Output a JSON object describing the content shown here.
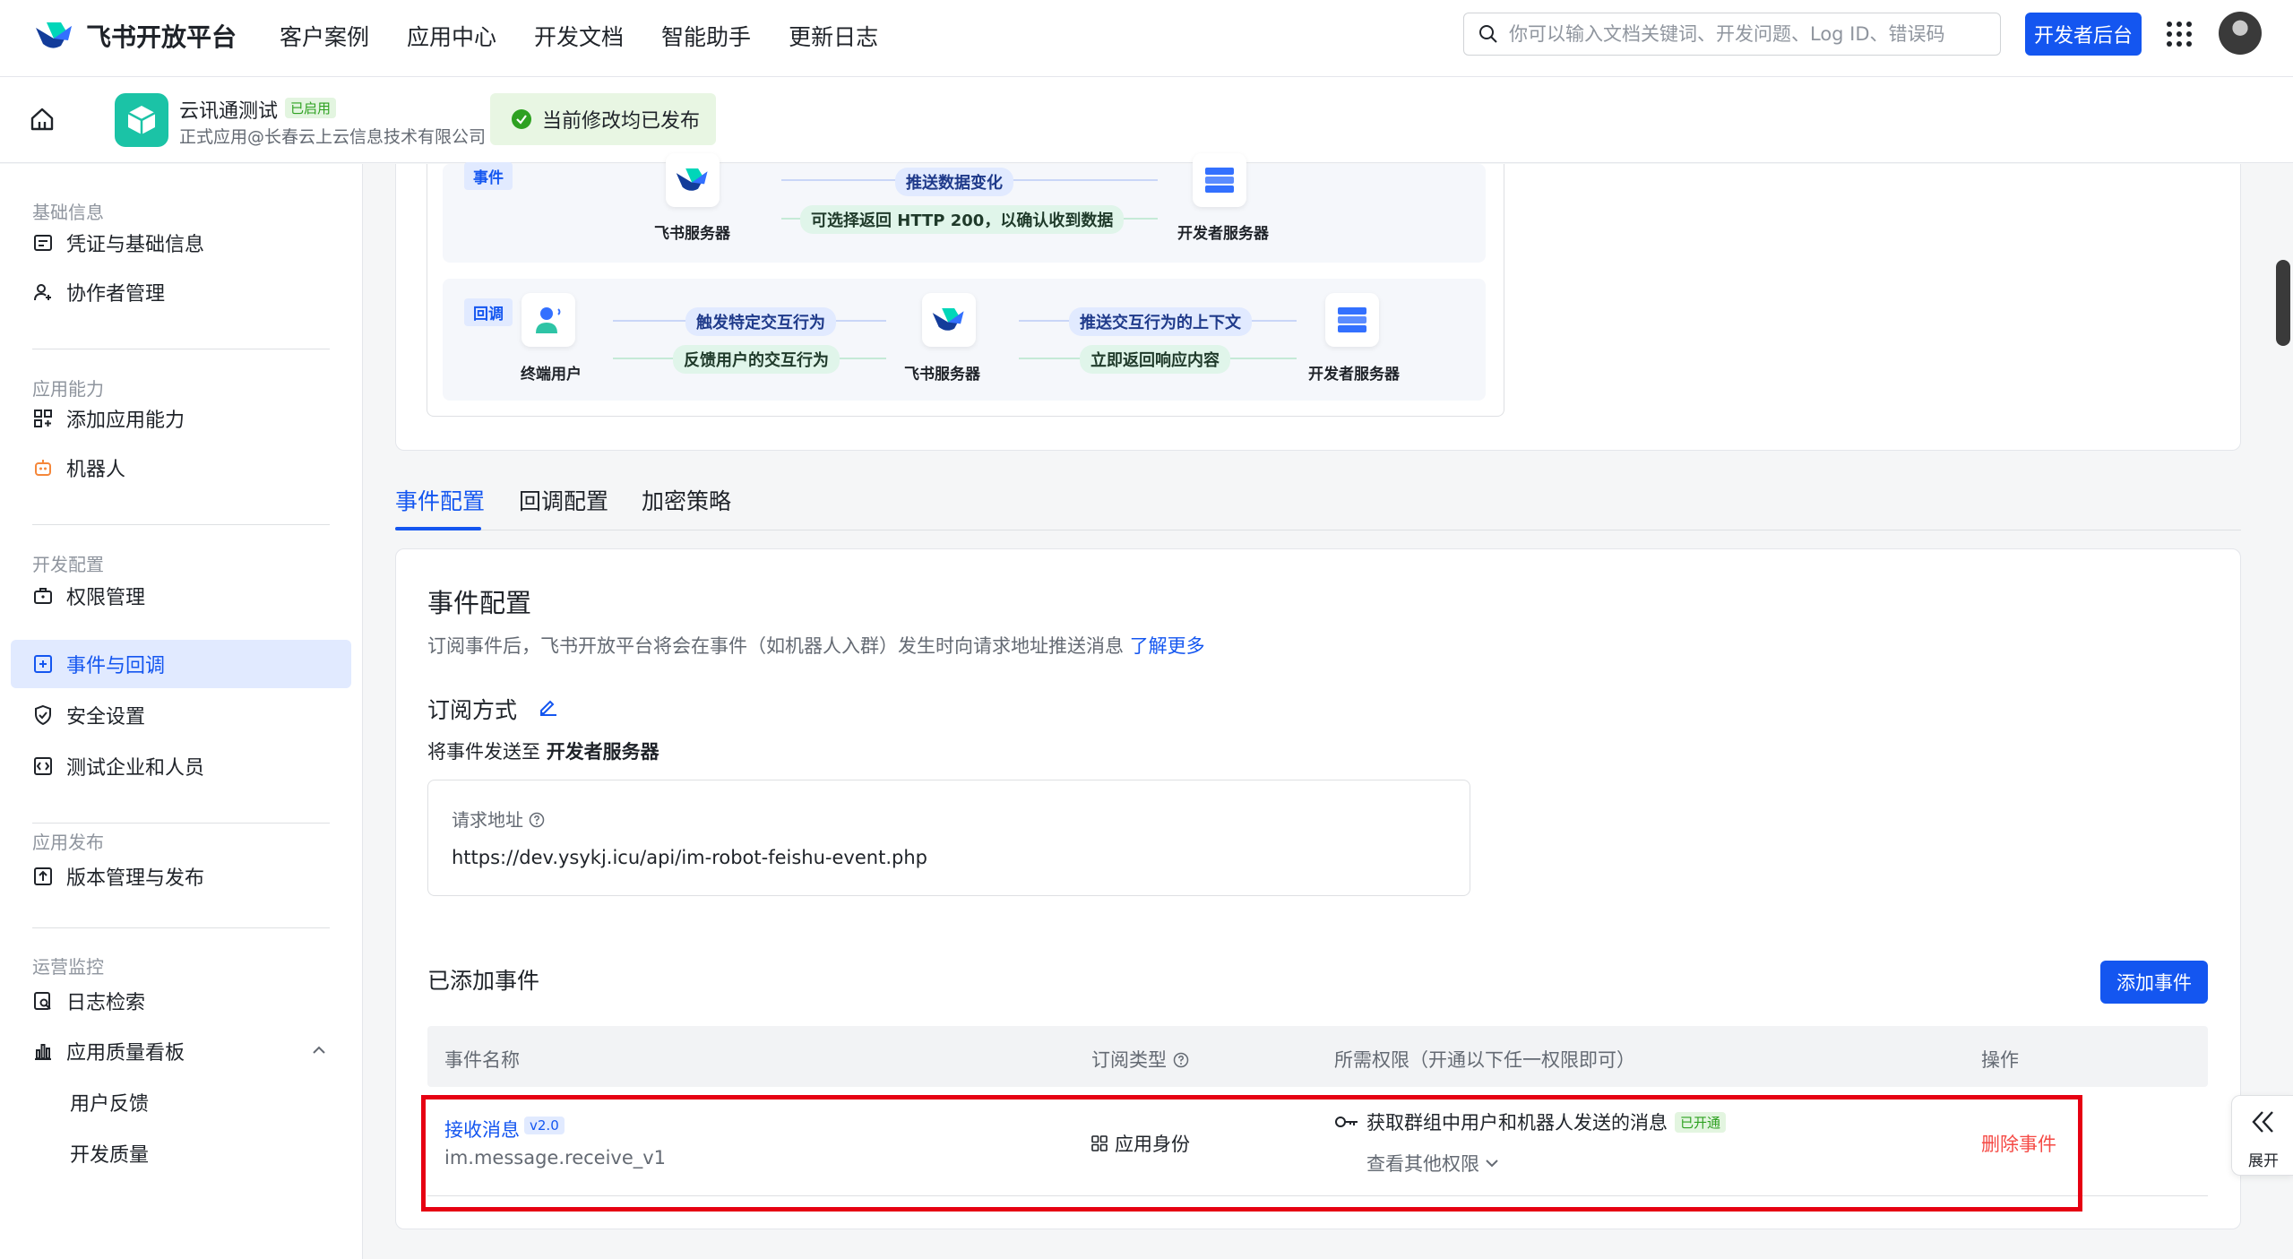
{
  "topnav": {
    "brand": "飞书开放平台",
    "links": [
      "客户案例",
      "应用中心",
      "开发文档",
      "智能助手",
      "更新日志"
    ],
    "search_placeholder": "你可以输入文档关键词、开发问题、Log ID、错误码",
    "dev_button": "开发者后台"
  },
  "app": {
    "name": "云讯通测试",
    "status_badge": "已启用",
    "subtitle": "正式应用@长春云上云信息技术有限公司",
    "published_notice": "当前修改均已发布"
  },
  "sidebar": {
    "sections": [
      {
        "title": "基础信息",
        "items": [
          "凭证与基础信息",
          "协作者管理"
        ]
      },
      {
        "title": "应用能力",
        "items": [
          "添加应用能力",
          "机器人"
        ]
      },
      {
        "title": "开发配置",
        "items": [
          "权限管理",
          "事件与回调",
          "安全设置",
          "测试企业和人员"
        ]
      },
      {
        "title": "应用发布",
        "items": [
          "版本管理与发布"
        ]
      },
      {
        "title": "运营监控",
        "items": [
          "日志检索",
          "应用质量看板",
          "用户反馈",
          "开发质量"
        ]
      }
    ],
    "active_item": "事件与回调"
  },
  "diagram": {
    "event_tag": "事件",
    "callback_tag": "回调",
    "event_push": "推送数据变化",
    "event_return": "可选择返回 HTTP 200，以确认收到数据",
    "feishu_server": "飞书服务器",
    "dev_server": "开发者服务器",
    "end_user": "终端用户",
    "trigger": "触发特定交互行为",
    "feedback": "反馈用户的交互行为",
    "push_context": "推送交互行为的上下文",
    "return_response": "立即返回响应内容"
  },
  "tabs": [
    "事件配置",
    "回调配置",
    "加密策略"
  ],
  "event_config": {
    "title": "事件配置",
    "desc": "订阅事件后，飞书开放平台将会在事件（如机器人入群）发生时向请求地址推送消息",
    "learn_more": "了解更多",
    "subscribe_title": "订阅方式",
    "send_to_prefix": "将事件发送至",
    "send_to_target": "开发者服务器",
    "url_label": "请求地址",
    "url_value": "https://dev.ysykj.icu/api/im-robot-feishu-event.php",
    "added_title": "已添加事件",
    "add_button": "添加事件",
    "columns": [
      "事件名称",
      "订阅类型",
      "所需权限（开通以下任一权限即可）",
      "操作"
    ],
    "rows": [
      {
        "name": "接收消息",
        "version": "v2.0",
        "code": "im.message.receive_v1",
        "type": "应用身份",
        "permission": "获取群组中用户和机器人发送的消息",
        "permission_badge": "已开通",
        "more_permissions": "查看其他权限",
        "action": "删除事件"
      }
    ]
  },
  "expand_label": "展开",
  "colors": {
    "accent": "#1456f0",
    "success": "#2ea121",
    "danger": "#f54a45",
    "highlight": "#e60012"
  }
}
